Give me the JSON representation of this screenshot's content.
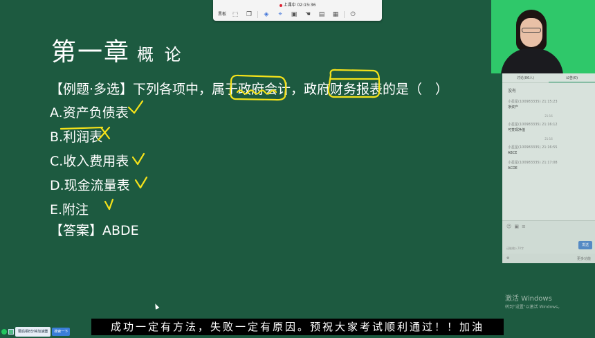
{
  "toolbar": {
    "status": "上课中 02:15:36",
    "mode_label": "黑板",
    "tools": [
      "select-icon",
      "copy-icon",
      "shapes-icon",
      "pin-icon",
      "image-icon",
      "hand-icon",
      "board-icon",
      "grid-icon",
      "document-icon",
      "power-icon"
    ]
  },
  "slide": {
    "title": "第一章",
    "subtitle": "概 论",
    "question": "【例题·多选】下列各项中，属于政府会计，政府财务报表的是（　）",
    "options": [
      "A.资产负债表",
      "B.利润表",
      "C.收入费用表",
      "D.现金流量表",
      "E.附注"
    ],
    "answer": "【答案】ABDE",
    "marks": [
      "check",
      "cross",
      "check",
      "check",
      "check"
    ]
  },
  "chat": {
    "tabs": [
      "讨论(86人)",
      "公告(0)"
    ],
    "empty_notice": "没有",
    "messages": [
      {
        "user": "小星星(100983335)",
        "time": "21:15:23",
        "text": "净资产"
      },
      {
        "user": "小星星(100983335)",
        "time": "21:16:12",
        "text": "可变现净值"
      },
      {
        "user": "小星星(100983335)",
        "time": "21:16:55",
        "text": "ABCE"
      },
      {
        "user": "小星星(100983335)",
        "time": "21:17:08",
        "text": "ACDE"
      }
    ],
    "separators": [
      "21:16",
      "21:16"
    ],
    "input_placeholder": "还能输入70字",
    "send_label": "发送",
    "footer_left": "",
    "footer_right": "更多功能"
  },
  "subtitle_text": "成功一定有方法，失败一定有原因。预祝大家考试顺利通过！！加油",
  "watermark": {
    "line1": "激活 Windows",
    "line2": "转到\"设置\"以激活 Windows。"
  },
  "taskbar": {
    "app_label": "要后相8分钟加速器",
    "button_label": "搜索一下"
  },
  "colors": {
    "background": "#1d5a40",
    "annotation": "#f5e21a",
    "video_bg": "#2fc86a"
  }
}
